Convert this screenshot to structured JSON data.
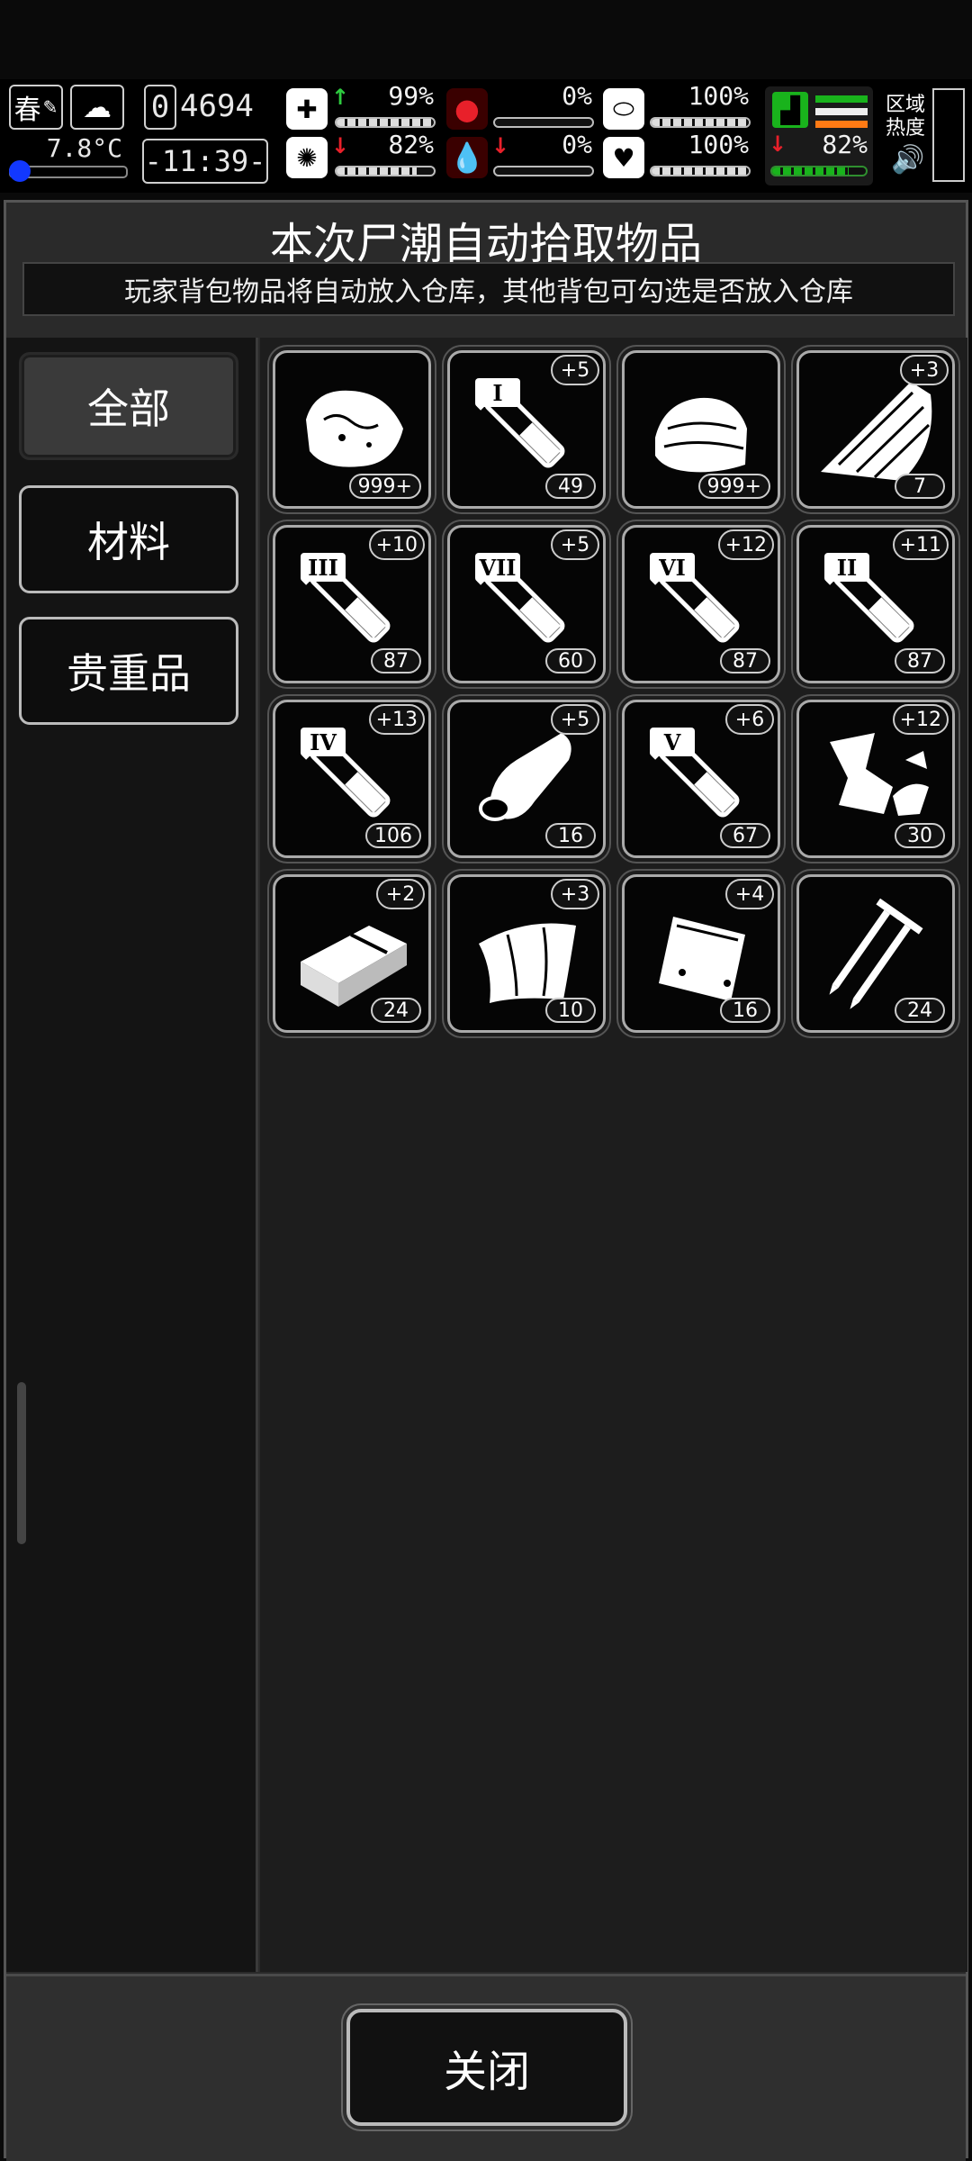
{
  "hud": {
    "season": "春",
    "temperature": "7.8°C",
    "day_digit": "0",
    "day_count": "4694",
    "clock": "-11:39-",
    "stats": [
      {
        "name": "health",
        "value": "99%",
        "trend": "up",
        "fill": 0.99
      },
      {
        "name": "hunger",
        "value": "0%",
        "trend": "none",
        "fill": 0.0
      },
      {
        "name": "pill",
        "value": "100%",
        "trend": "none",
        "fill": 1.0
      },
      {
        "name": "sanity",
        "value": "82%",
        "trend": "down",
        "fill": 0.82
      },
      {
        "name": "blood",
        "value": "0%",
        "trend": "down",
        "fill": 0.0
      },
      {
        "name": "heart",
        "value": "100%",
        "trend": "none",
        "fill": 1.0
      },
      {
        "name": "stamina",
        "value": "82%",
        "trend": "down",
        "fill": 0.82
      }
    ],
    "zone_heat_label": "区域\n热度"
  },
  "panel": {
    "title": "本次尸潮自动拾取物品",
    "subtitle": "玩家背包物品将自动放入仓库，其他背包可勾选是否放入仓库"
  },
  "tabs": [
    {
      "label": "全部",
      "active": true
    },
    {
      "label": "材料",
      "active": false
    },
    {
      "label": "贵重品",
      "active": false
    }
  ],
  "items": [
    {
      "icon": "meat-icon",
      "count": "999+",
      "bonus": ""
    },
    {
      "icon": "syringe-icon",
      "roman": "I",
      "count": "49",
      "bonus": "+5"
    },
    {
      "icon": "cloth-icon",
      "count": "999+",
      "bonus": ""
    },
    {
      "icon": "wood-plank-icon",
      "count": "7",
      "bonus": "+3"
    },
    {
      "icon": "syringe-icon",
      "roman": "III",
      "count": "87",
      "bonus": "+10"
    },
    {
      "icon": "syringe-icon",
      "roman": "VII",
      "count": "60",
      "bonus": "+5"
    },
    {
      "icon": "syringe-icon",
      "roman": "VI",
      "count": "87",
      "bonus": "+12"
    },
    {
      "icon": "syringe-icon",
      "roman": "II",
      "count": "87",
      "bonus": "+11"
    },
    {
      "icon": "syringe-icon",
      "roman": "IV",
      "count": "106",
      "bonus": "+13"
    },
    {
      "icon": "bandage-icon",
      "count": "16",
      "bonus": "+5"
    },
    {
      "icon": "syringe-icon",
      "roman": "V",
      "count": "67",
      "bonus": "+6"
    },
    {
      "icon": "scrap-metal-icon",
      "count": "30",
      "bonus": "+12"
    },
    {
      "icon": "box-icon",
      "count": "24",
      "bonus": "+2"
    },
    {
      "icon": "fabric-sheet-icon",
      "count": "10",
      "bonus": "+3"
    },
    {
      "icon": "pouch-icon",
      "count": "16",
      "bonus": "+4"
    },
    {
      "icon": "nails-icon",
      "count": "24",
      "bonus": ""
    }
  ],
  "footer": {
    "close_label": "关闭"
  }
}
